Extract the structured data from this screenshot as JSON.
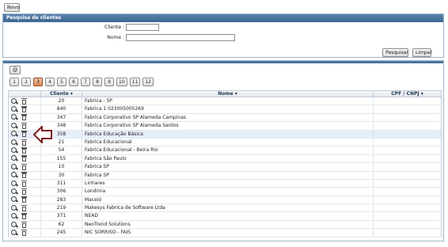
{
  "top": {
    "new_label": "Novo"
  },
  "search": {
    "title": "Pesquisa de clientes",
    "cliente_label": "Cliente :",
    "cliente_value": "",
    "nome_label": "Nome :",
    "nome_value": "",
    "search_label": "Pesquisar",
    "clear_label": "Limpar"
  },
  "results": {
    "at_label": "@",
    "pages": [
      "1",
      "2",
      "3",
      "4",
      "5",
      "6",
      "7",
      "8",
      "9",
      "10",
      "11",
      "12"
    ],
    "active_page": "3",
    "headers": {
      "cliente": "Cliente ▾",
      "nome": "Nome ▾",
      "cpf": "CPF / CNPJ ▾"
    },
    "rows": [
      {
        "cliente": "20",
        "nome": "Fabrica - SP"
      },
      {
        "cliente": "840",
        "nome": "Fabrica 1 023005005269"
      },
      {
        "cliente": "347",
        "nome": "Fabrica Corporativo SP Alameda Campinas"
      },
      {
        "cliente": "348",
        "nome": "Fabrica Corporativo SP Alameda Santos"
      },
      {
        "cliente": "358",
        "nome": "Fabrica Educação Básica"
      },
      {
        "cliente": "21",
        "nome": "Fabrica Educacional"
      },
      {
        "cliente": "54",
        "nome": "Fabrica Educacional - Beira Rio"
      },
      {
        "cliente": "155",
        "nome": "Fabrica São Paulo"
      },
      {
        "cliente": "10",
        "nome": "Fabrica SP"
      },
      {
        "cliente": "30",
        "nome": "Fabrica SP"
      },
      {
        "cliente": "311",
        "nome": "Linhares"
      },
      {
        "cliente": "306",
        "nome": "Londrina"
      },
      {
        "cliente": "283",
        "nome": "Maceió"
      },
      {
        "cliente": "219",
        "nome": "Makesys Fabrica de Software Ltda"
      },
      {
        "cliente": "371",
        "nome": "NEAD"
      },
      {
        "cliente": "62",
        "nome": "NeoTrend Solutions"
      },
      {
        "cliente": "245",
        "nome": "NIC SORRISO - FAIS"
      }
    ],
    "selected_index": 4
  },
  "colors": {
    "header_blue": "#4a73a0",
    "active_page": "#d98a55",
    "arrow": "#7a1f1f"
  }
}
